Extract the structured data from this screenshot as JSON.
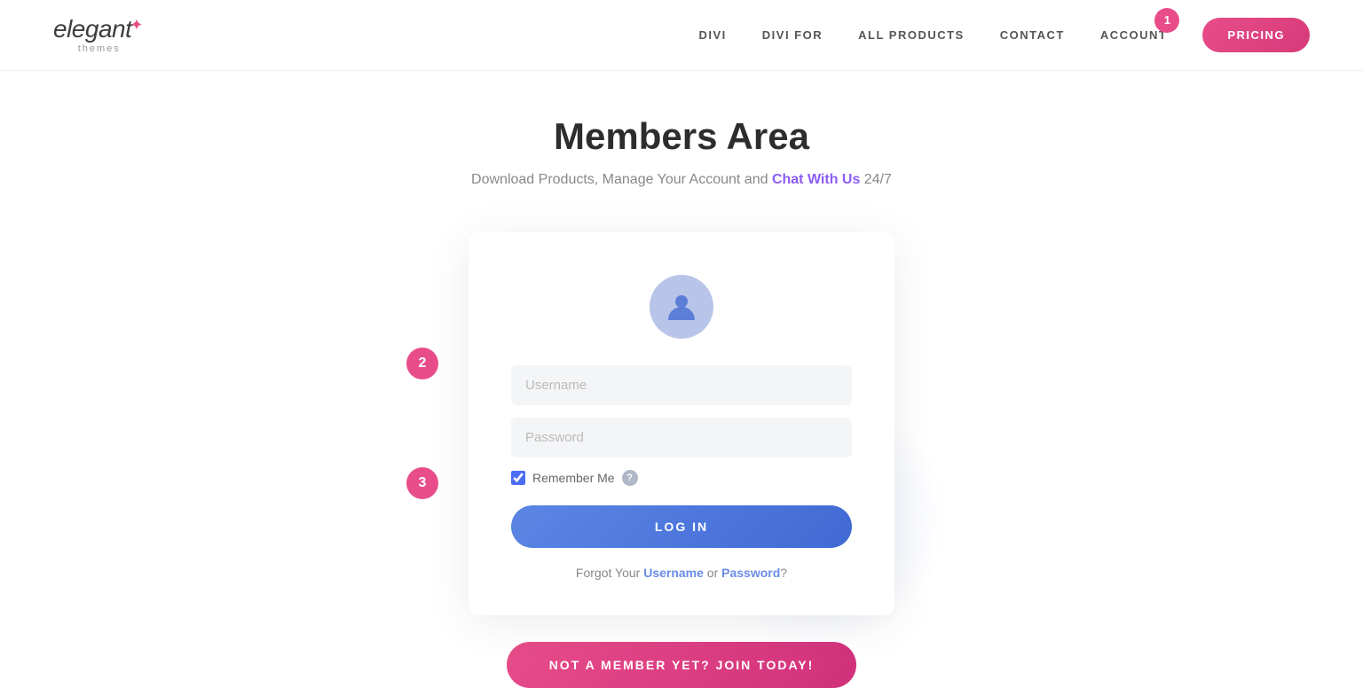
{
  "header": {
    "logo": {
      "elegant": "elegant",
      "star": "✦",
      "themes": "themes"
    },
    "nav": {
      "items": [
        {
          "id": "divi",
          "label": "DIVI"
        },
        {
          "id": "divi-for",
          "label": "DIVI FOR"
        },
        {
          "id": "all-products",
          "label": "ALL PRODUCTS"
        },
        {
          "id": "contact",
          "label": "CONTACT"
        },
        {
          "id": "account",
          "label": "ACCOUNT"
        }
      ],
      "account_badge": "1",
      "pricing_label": "PRICING"
    }
  },
  "main": {
    "title": "Members Area",
    "subtitle_before": "Download Products, Manage Your Account and ",
    "subtitle_link": "Chat With Us",
    "subtitle_after": " 24/7"
  },
  "login_card": {
    "username_placeholder": "Username",
    "password_placeholder": "Password",
    "remember_me_label": "Remember Me",
    "login_button": "LOG IN",
    "forgot_text": "Forgot Your ",
    "forgot_username": "Username",
    "forgot_or": " or ",
    "forgot_password": "Password",
    "forgot_end": "?",
    "annotation_2": "2",
    "annotation_3": "3"
  },
  "join": {
    "button_label": "NOT A MEMBER YET? JOIN TODAY!"
  }
}
